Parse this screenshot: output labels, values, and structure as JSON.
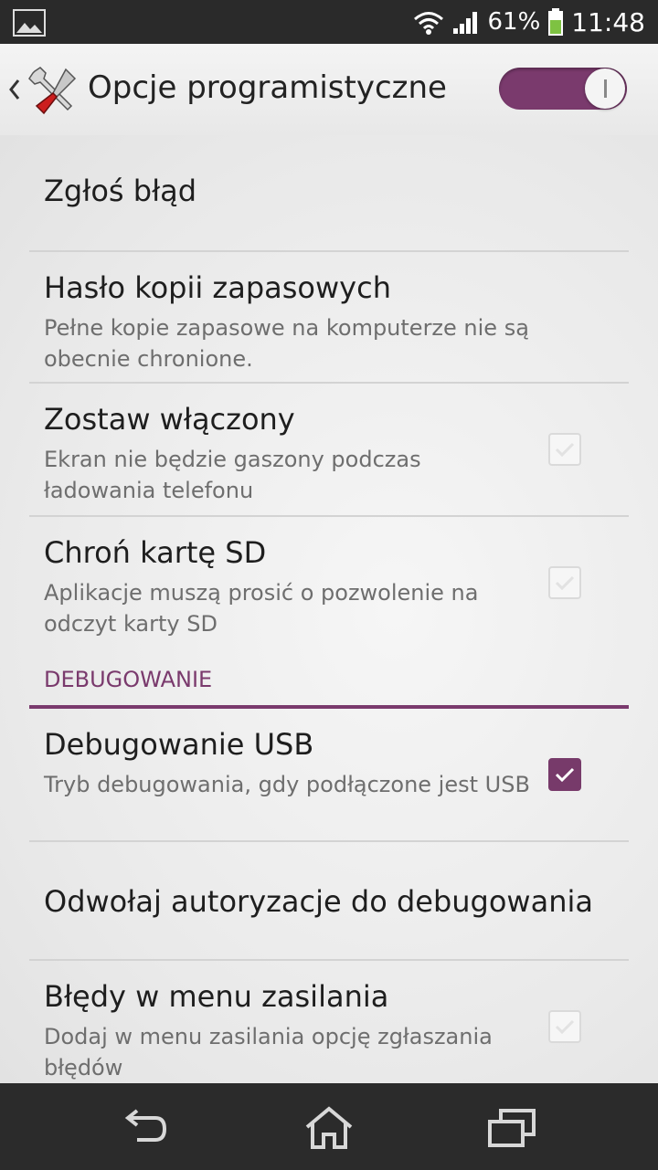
{
  "status_bar": {
    "battery": "61%",
    "time": "11:48",
    "icons": [
      "image-notification-icon",
      "wifi-icon",
      "signal-icon",
      "battery-icon"
    ]
  },
  "action_bar": {
    "title": "Opcje programistyczne",
    "master_toggle": "on"
  },
  "preferences": [
    {
      "title": "Zgłoś błąd"
    },
    {
      "title": "Hasło kopii zapasowych",
      "summary": "Pełne kopie zapasowe na komputerze nie są obecnie chronione."
    },
    {
      "title": "Zostaw włączony",
      "summary": "Ekran nie będzie gaszony podczas ładowania telefonu",
      "checked": false
    },
    {
      "title": "Chroń kartę SD",
      "summary": "Aplikacje muszą prosić o pozwolenie na odczyt karty SD",
      "checked": false
    }
  ],
  "section": {
    "header": "DEBUGOWANIE"
  },
  "debug_preferences": [
    {
      "title": "Debugowanie USB",
      "summary": "Tryb debugowania, gdy podłączone jest USB",
      "checked": true
    },
    {
      "title": "Odwołaj autoryzacje do debugowania"
    },
    {
      "title": "Błędy w menu zasilania",
      "summary": "Dodaj w menu zasilania opcję zgłaszania błędów",
      "checked": false
    }
  ],
  "nav_bar": {
    "icons": [
      "back-icon",
      "home-icon",
      "recent-apps-icon"
    ]
  },
  "colors": {
    "accent": "#7a3a6d",
    "status_bar": "#2a2a2a",
    "nav_bar": "#2b2b2b"
  }
}
